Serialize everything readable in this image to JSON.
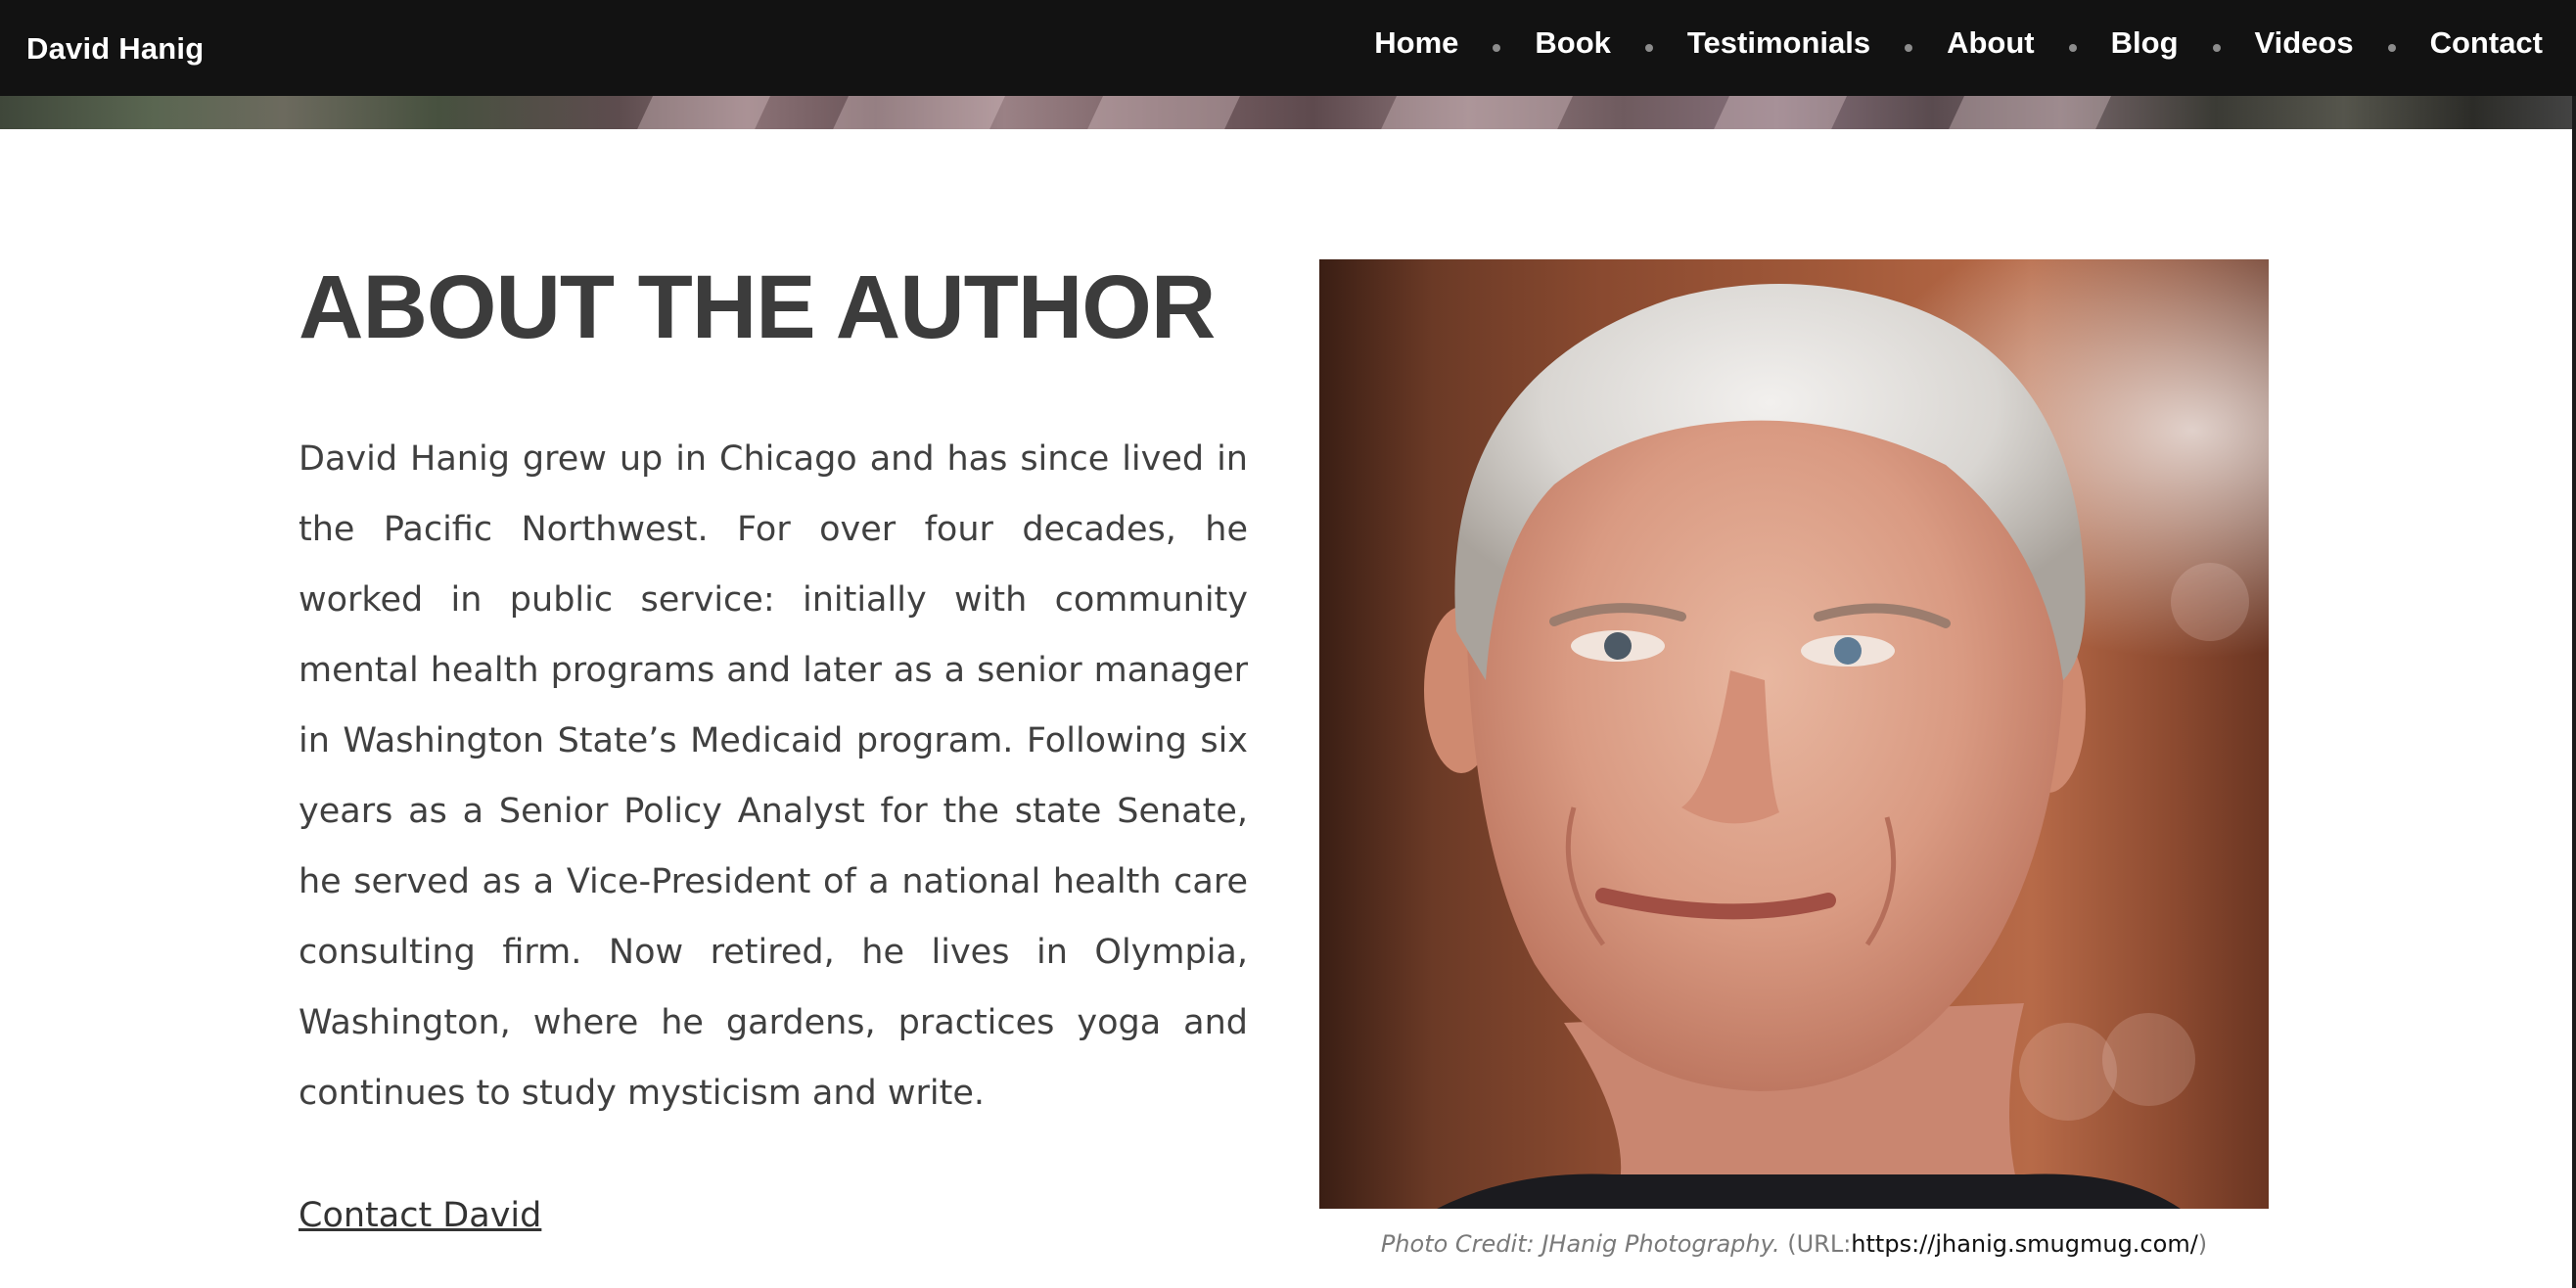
{
  "header": {
    "site_title": "David Hanig",
    "nav": [
      {
        "label": "Home"
      },
      {
        "label": "Book"
      },
      {
        "label": "Testimonials"
      },
      {
        "label": "About"
      },
      {
        "label": "Blog"
      },
      {
        "label": "Videos"
      },
      {
        "label": "Contact"
      }
    ]
  },
  "main": {
    "title": "ABOUT THE AUTHOR",
    "bio": "David Hanig grew up in Chicago and has since lived in the Pacific Northwest. For over four decades, he worked in public service: initially with community mental health programs and later as a senior manager in Washington State’s Medicaid program. Following six years as a Senior Policy Analyst for the state Senate, he served as a Vice-President of a national health care consulting firm. Now retired, he lives in Olympia, Washington, where he gardens, practices yoga and continues to study mysticism and write.",
    "contact_link": "Contact David"
  },
  "photo": {
    "icon": "author-portrait-photo",
    "caption_credit": "Photo Credit:  JHanig Photography.",
    "caption_url_prefix": "(URL:",
    "caption_url": "https://jhanig.smugmug.com/",
    "caption_url_suffix": ")"
  },
  "colors": {
    "header_bg": "#121212",
    "nav_text": "#ffffff",
    "heading": "#3c3c3c",
    "body_text": "#404040"
  }
}
